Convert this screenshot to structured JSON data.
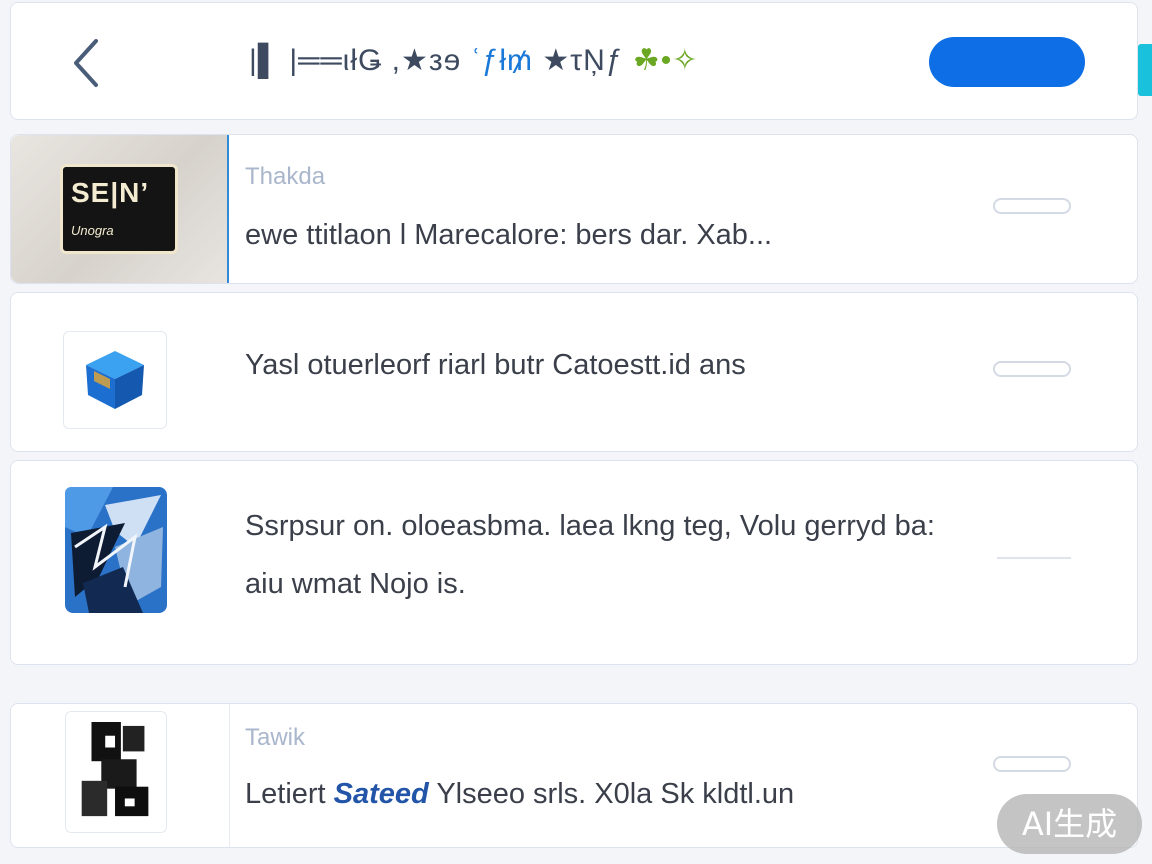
{
  "header": {
    "title_parts": [
      "|▌ |══ιłǤ ,★зɘ ",
      "ʿƒł₥ ",
      "★τŅƒ ",
      "☘•✧"
    ],
    "primary_button_label": ""
  },
  "cards": [
    {
      "logo_main": "SE|N’",
      "logo_sub": "Unogra",
      "label": "Thakda",
      "text": "ewe ttitlaon l Marecalore: bers dar. Xab..."
    },
    {
      "label": "",
      "text": "Yasl otuerleorf riarl butr Catoestt.id ans"
    },
    {
      "label": "",
      "text": "Ssrpsur on. oloeasbma. laea lkng teg, Volu gerryd ba: aiu wmat Nojo is."
    },
    {
      "label": "Tawik",
      "text_before": "Letiert ",
      "text_emph": "Sateed",
      "text_after": " Ylseeo srls. X0la Sk kldtl.un"
    }
  ],
  "badge": {
    "label": "AI生成"
  },
  "colors": {
    "accent": "#0d6ee6",
    "edge_tab": "#19c1dc",
    "label_muted": "#a9b6cc",
    "text": "#3a3f4a"
  },
  "icons": {
    "back": "chevron-left-icon",
    "card2": "blue-cube-icon",
    "card3": "blue-shard-app-icon",
    "card4": "bw-photo-thumbnail"
  }
}
